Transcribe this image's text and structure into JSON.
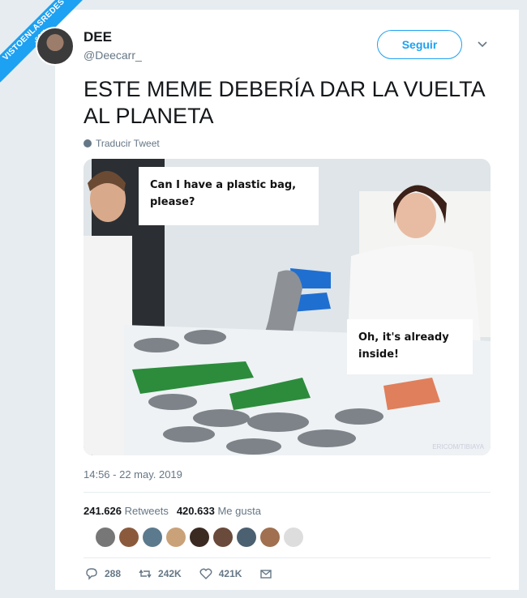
{
  "watermark_ribbon": {
    "main": "VISTOENLASREDES",
    "sub": ".com"
  },
  "user": {
    "name": "DEE",
    "handle": "@Deecarr_"
  },
  "follow_label": "Seguir",
  "tweet": {
    "text": "ESTE MEME DEBERÍA DAR LA VUELTA AL PLANETA",
    "translate_label": "Traducir Tweet",
    "timestamp": "14:56 - 22 may. 2019"
  },
  "media": {
    "bubble_top": "Can I have a plastic bag, please?",
    "bubble_bottom": "Oh, it's already inside!",
    "watermark": "ERICOM/TIBIAYA"
  },
  "stats": {
    "retweets_count": "241.626",
    "retweets_label": "Retweets",
    "likes_count": "420.633",
    "likes_label": "Me gusta"
  },
  "likers": [
    "#777",
    "#8b5a3c",
    "#5c7a8e",
    "#c9a27a",
    "#3b2a22",
    "#6a4a3a",
    "#4b6070",
    "#a07050",
    "#ddd"
  ],
  "actions": {
    "replies": "288",
    "retweets": "242K",
    "likes": "421K"
  }
}
